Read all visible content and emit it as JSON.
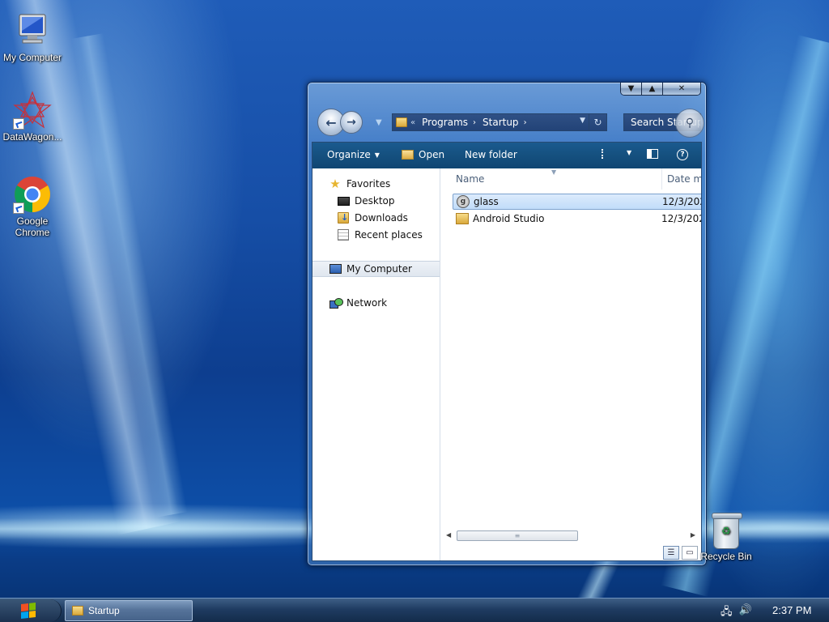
{
  "desktop": {
    "icons": [
      {
        "label": "My Computer",
        "icon": "computer-icon"
      },
      {
        "label": "DataWagon...",
        "icon": "datawagon-icon"
      },
      {
        "label": "Google Chrome",
        "icon": "chrome-icon"
      },
      {
        "label": "Recycle Bin",
        "icon": "recycle-bin-icon"
      }
    ]
  },
  "window": {
    "caption_buttons": {
      "minimize": "▼",
      "maximize": "▲",
      "close": "✕"
    },
    "address": {
      "crumbs": [
        "Programs",
        "Startup"
      ],
      "separator": "›",
      "history_arrows": "«"
    },
    "search": {
      "placeholder": "Search Startup"
    },
    "toolbar": {
      "organize": "Organize",
      "open": "Open",
      "new_folder": "New folder",
      "help": "?"
    },
    "nav_pane": {
      "favorites": "Favorites",
      "items": [
        "Desktop",
        "Downloads",
        "Recent places"
      ],
      "computer": "My Computer",
      "network": "Network"
    },
    "columns": {
      "name": "Name",
      "date": "Date mo"
    },
    "files": [
      {
        "name": "glass",
        "date": "12/3/202",
        "type": "shortcut",
        "selected": true
      },
      {
        "name": "Android Studio",
        "date": "12/3/202",
        "type": "folder",
        "selected": false
      }
    ],
    "scroll": {
      "thumb_grip": "≡"
    }
  },
  "taskbar": {
    "task_button": "Startup",
    "clock": "2:37 PM"
  }
}
